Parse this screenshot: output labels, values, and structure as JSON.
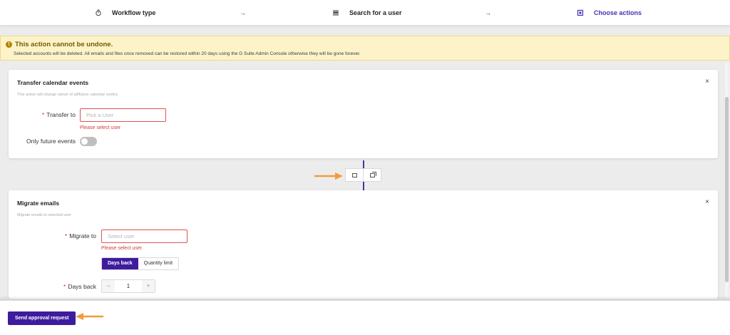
{
  "stepper": {
    "steps": [
      {
        "label": "Workflow type",
        "icon": "workflow-icon"
      },
      {
        "label": "Search for a user",
        "icon": "search-user-icon"
      },
      {
        "label": "Choose actions",
        "icon": "actions-icon"
      }
    ],
    "separator": "→",
    "active_color": "#4b2fb5"
  },
  "alert": {
    "title": "This action cannot be undone.",
    "description": "Selected accounts will be deleted. All emails and files once removed can be restored within 20 days using the G Suite Admin Console otherwise they will be gone forever."
  },
  "card1": {
    "title": "Transfer calendar events",
    "subtitle": "This action will change owner of all/future calendar evetns",
    "close": "×",
    "transfer_label": "Transfer to",
    "transfer_placeholder": "Pick a User",
    "error": "Please select user",
    "toggle_label": "Only future events",
    "toggle_on": false
  },
  "card2": {
    "title": "Migrate emails",
    "subtitle": "Migrate emails to selected user",
    "close": "×",
    "migrate_label": "Migrate to",
    "migrate_placeholder": "Select user",
    "error": "Please select user",
    "options": [
      "Days back",
      "Quantity limit"
    ],
    "selected_option": "Days back",
    "days_label": "Days back",
    "days_value": "1",
    "minus": "−",
    "plus": "+"
  },
  "required_mark": "*",
  "footer": {
    "submit_label": "Send approval request"
  },
  "colors": {
    "primary": "#3d1c9e",
    "error": "#d13b3b",
    "annotation": "#f39b3c",
    "warning_bg": "#fdf3c9"
  }
}
